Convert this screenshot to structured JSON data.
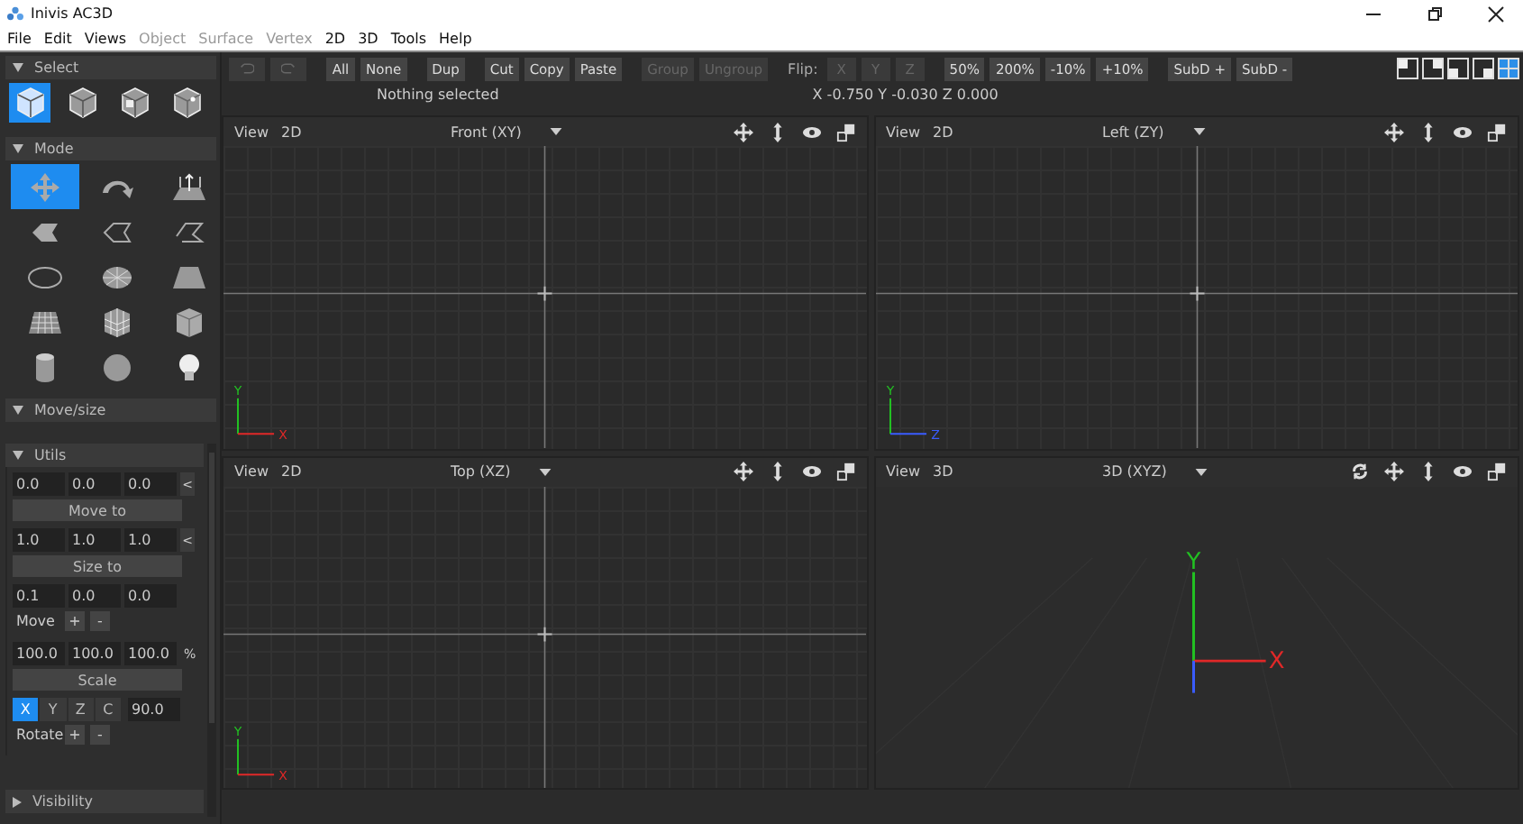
{
  "window": {
    "title": "Inivis AC3D",
    "controls": [
      {
        "kind": "minimize"
      },
      {
        "kind": "restore"
      },
      {
        "kind": "close"
      }
    ]
  },
  "menu": [
    {
      "label": "File",
      "disabled": false
    },
    {
      "label": "Edit",
      "disabled": false
    },
    {
      "label": "Views",
      "disabled": false
    },
    {
      "label": "Object",
      "disabled": true
    },
    {
      "label": "Surface",
      "disabled": true
    },
    {
      "label": "Vertex",
      "disabled": true
    },
    {
      "label": "2D",
      "disabled": false
    },
    {
      "label": "3D",
      "disabled": false
    },
    {
      "label": "Tools",
      "disabled": false
    },
    {
      "label": "Help",
      "disabled": false
    }
  ],
  "sidebar": {
    "select": {
      "title": "Select",
      "expanded": true,
      "tools": [
        {
          "kind": "object",
          "selected": true
        },
        {
          "kind": "group",
          "selected": false
        },
        {
          "kind": "surface",
          "selected": false
        },
        {
          "kind": "vertex",
          "selected": false
        }
      ]
    },
    "mode": {
      "title": "Mode",
      "expanded": true,
      "tools": [
        {
          "kind": "move",
          "selected": true
        },
        {
          "kind": "rotate",
          "selected": false
        },
        {
          "kind": "extrude",
          "selected": false
        },
        {
          "kind": "polygon",
          "selected": false
        },
        {
          "kind": "polyline",
          "selected": false
        },
        {
          "kind": "line",
          "selected": false
        },
        {
          "kind": "ellipse",
          "selected": false
        },
        {
          "kind": "disc",
          "selected": false
        },
        {
          "kind": "plane",
          "selected": false
        },
        {
          "kind": "grid",
          "selected": false
        },
        {
          "kind": "mesh",
          "selected": false
        },
        {
          "kind": "box",
          "selected": false
        },
        {
          "kind": "cylinder",
          "selected": false
        },
        {
          "kind": "sphere",
          "selected": false
        },
        {
          "kind": "light",
          "selected": false
        }
      ]
    },
    "move_size": {
      "title": "Move/size",
      "expanded": true
    },
    "utils": {
      "title": "Utils",
      "expanded": true,
      "move_to": {
        "values": [
          "0.0",
          "0.0",
          "0.0"
        ],
        "side": "<",
        "button": "Move to"
      },
      "size_to": {
        "values": [
          "1.0",
          "1.0",
          "1.0"
        ],
        "side": "<",
        "button": "Size to"
      },
      "move": {
        "values": [
          "0.1",
          "0.0",
          "0.0"
        ],
        "label": "Move",
        "plus": "+",
        "minus": "-"
      },
      "scale": {
        "values": [
          "100.0",
          "100.0",
          "100.0"
        ],
        "unit": "%",
        "button": "Scale"
      },
      "rotate": {
        "axes": [
          {
            "label": "X",
            "selected": true
          },
          {
            "label": "Y",
            "selected": false
          },
          {
            "label": "Z",
            "selected": false
          },
          {
            "label": "C",
            "selected": false
          }
        ],
        "angle": "90.0",
        "label": "Rotate",
        "plus": "+",
        "minus": "-"
      }
    },
    "visibility": {
      "title": "Visibility",
      "expanded": false
    }
  },
  "toolbar": {
    "groups": [
      [
        {
          "kind": "undo",
          "disabled": true
        },
        {
          "kind": "redo",
          "disabled": true
        }
      ],
      [
        {
          "label": "All",
          "disabled": false
        },
        {
          "label": "None",
          "disabled": false
        }
      ],
      [
        {
          "label": "Dup",
          "disabled": false
        }
      ],
      [
        {
          "label": "Cut",
          "disabled": false
        },
        {
          "label": "Copy",
          "disabled": false
        },
        {
          "label": "Paste",
          "disabled": false
        }
      ],
      [
        {
          "label": "Group",
          "disabled": true
        },
        {
          "label": "Ungroup",
          "disabled": true
        }
      ],
      [
        {
          "kind": "label",
          "label": "Flip:"
        },
        {
          "label": "X",
          "disabled": true
        },
        {
          "label": "Y",
          "disabled": true
        },
        {
          "label": "Z",
          "disabled": true
        }
      ],
      [
        {
          "label": "50%",
          "disabled": false
        },
        {
          "label": "200%",
          "disabled": false
        },
        {
          "label": "-10%",
          "disabled": false
        },
        {
          "label": "+10%",
          "disabled": false
        }
      ],
      [
        {
          "label": "SubD +",
          "disabled": false
        },
        {
          "label": "SubD -",
          "disabled": false
        }
      ]
    ],
    "layouts": [
      {
        "kind": "top-left",
        "selected": false
      },
      {
        "kind": "top-right",
        "selected": false
      },
      {
        "kind": "bottom-left",
        "selected": false
      },
      {
        "kind": "bottom-right",
        "selected": false
      },
      {
        "kind": "quad",
        "selected": true
      }
    ]
  },
  "status": {
    "selection": "Nothing selected",
    "coordinates": "X -0.750 Y -0.030 Z 0.000"
  },
  "viewports": [
    {
      "view_menu": "View",
      "dimension": "2D",
      "projection": "Front (XY)",
      "kind": "flat",
      "axes": [
        {
          "kind": "y",
          "label": "Y"
        },
        {
          "kind": "x",
          "label": "X"
        }
      ],
      "tools": [
        {
          "kind": "pan"
        },
        {
          "kind": "zoom"
        },
        {
          "kind": "eye"
        },
        {
          "kind": "maximize"
        }
      ]
    },
    {
      "view_menu": "View",
      "dimension": "2D",
      "projection": "Left (ZY)",
      "kind": "flat",
      "axes": [
        {
          "kind": "y",
          "label": "Y"
        },
        {
          "kind": "z",
          "label": "Z"
        }
      ],
      "tools": [
        {
          "kind": "pan"
        },
        {
          "kind": "zoom"
        },
        {
          "kind": "eye"
        },
        {
          "kind": "maximize"
        }
      ]
    },
    {
      "view_menu": "View",
      "dimension": "2D",
      "projection": "Top (XZ)",
      "kind": "flat",
      "axes": [
        {
          "kind": "y",
          "label": "Y"
        },
        {
          "kind": "x",
          "label": "X"
        }
      ],
      "tools": [
        {
          "kind": "pan"
        },
        {
          "kind": "zoom"
        },
        {
          "kind": "eye"
        },
        {
          "kind": "maximize"
        }
      ]
    },
    {
      "view_menu": "View",
      "dimension": "3D",
      "projection": "3D (XYZ)",
      "kind": "perspective",
      "axes": [
        {
          "kind": "y",
          "label": "Y"
        },
        {
          "kind": "x",
          "label": "X"
        },
        {
          "kind": "z"
        }
      ],
      "tools": [
        {
          "kind": "rotate"
        },
        {
          "kind": "pan"
        },
        {
          "kind": "zoom"
        },
        {
          "kind": "eye"
        },
        {
          "kind": "maximize"
        }
      ]
    }
  ]
}
